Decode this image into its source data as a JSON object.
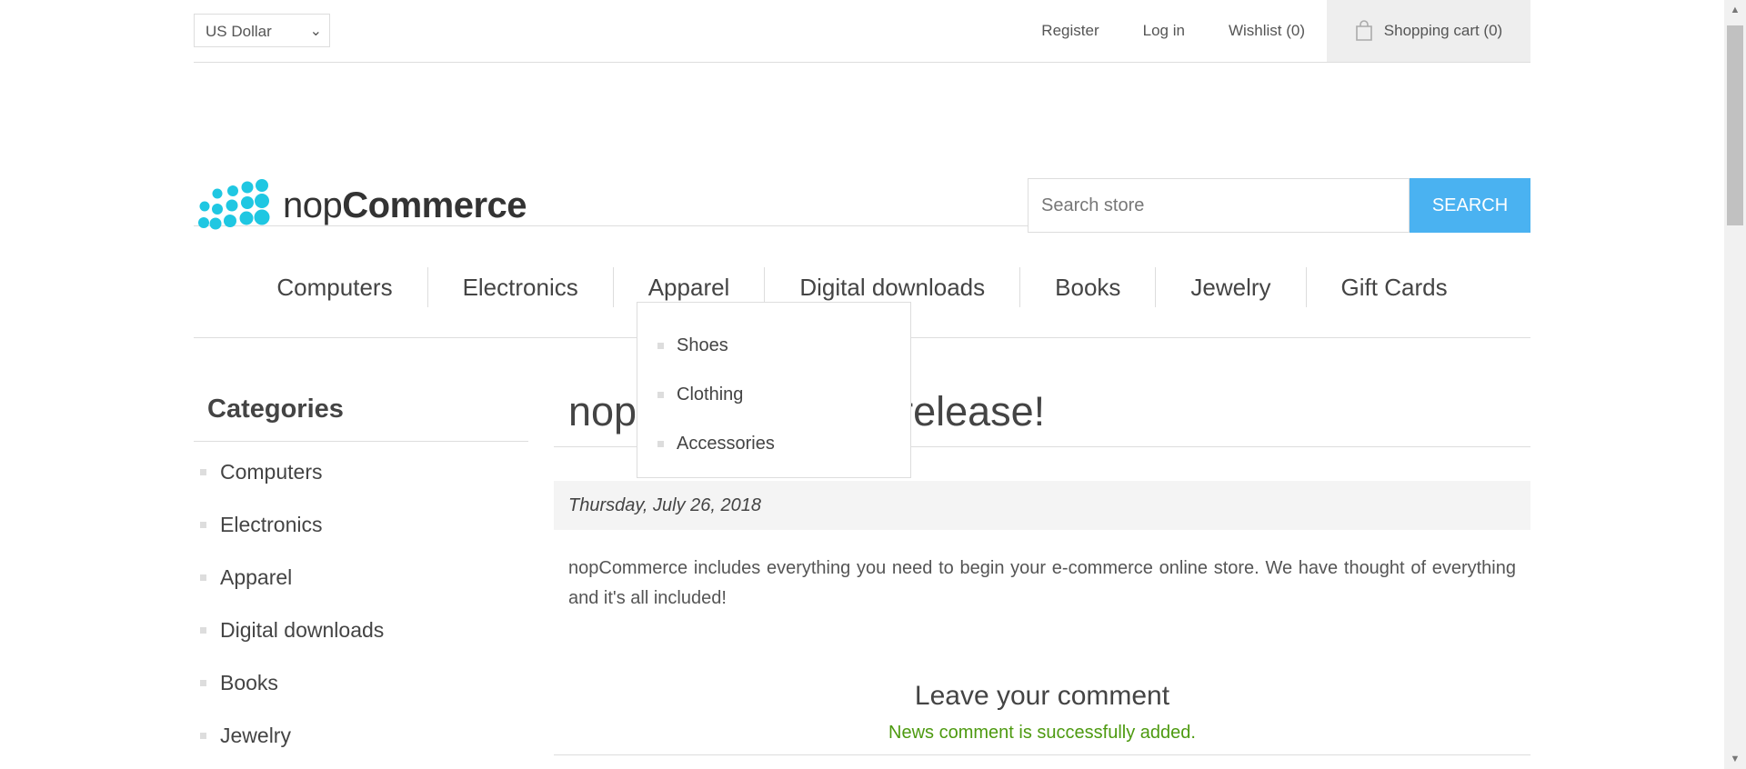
{
  "header": {
    "currency": "US Dollar",
    "register": "Register",
    "login": "Log in",
    "wishlist": "Wishlist (0)",
    "cart": "Shopping cart (0)"
  },
  "logo": {
    "text_light": "nop",
    "text_bold": "Commerce",
    "brand_color": "#1fc7e2"
  },
  "search": {
    "placeholder": "Search store",
    "button": "SEARCH"
  },
  "menu": {
    "items": [
      "Computers",
      "Electronics",
      "Apparel",
      "Digital downloads",
      "Books",
      "Jewelry",
      "Gift Cards"
    ],
    "apparel_submenu": [
      "Shoes",
      "Clothing",
      "Accessories"
    ]
  },
  "side": {
    "title": "Categories",
    "items": [
      "Computers",
      "Electronics",
      "Apparel",
      "Digital downloads",
      "Books",
      "Jewelry"
    ]
  },
  "news": {
    "title_left": "nop",
    "title_right": "w release!",
    "date": "Thursday, July 26, 2018",
    "body": "nopCommerce includes everything you need to begin your e-commerce online store. We have thought of everything and it's all included!",
    "comment_title": "Leave your comment",
    "comment_result": "News comment is successfully added."
  },
  "colors": {
    "accent": "#4ab2f1",
    "success": "#4d9a10"
  }
}
